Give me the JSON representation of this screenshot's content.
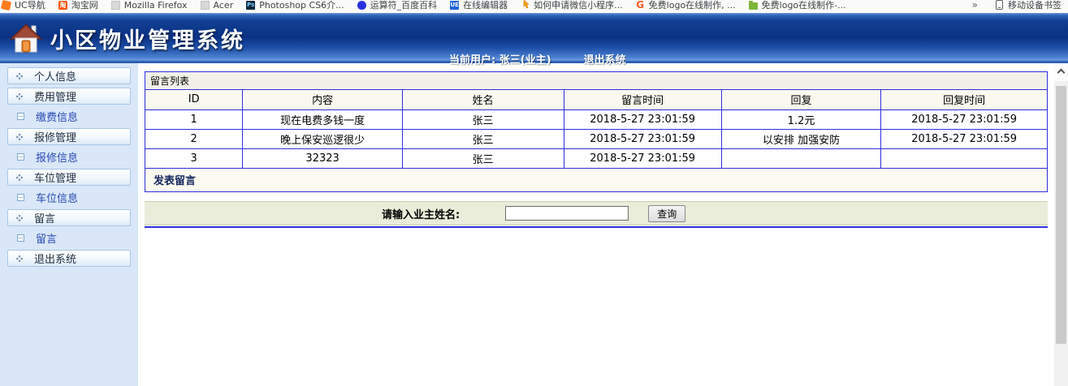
{
  "bookmarks_bar": {
    "items": [
      {
        "label": "UC导航",
        "icon": "uc-icon"
      },
      {
        "label": "淘宝网",
        "icon": "taobao-icon"
      },
      {
        "label": "Mozilla Firefox",
        "icon": "generic-page-icon"
      },
      {
        "label": "Acer",
        "icon": "generic-page-icon"
      },
      {
        "label": "Photoshop CS6介...",
        "icon": "photoshop-icon"
      },
      {
        "label": "运算符_百度百科",
        "icon": "baidu-icon"
      },
      {
        "label": "在线编辑器",
        "icon": "ue-icon"
      },
      {
        "label": "如何申请微信小程序...",
        "icon": "hand-cursor-icon"
      },
      {
        "label": "免费logo在线制作, ...",
        "icon": "g-icon"
      },
      {
        "label": "免费logo在线制作-...",
        "icon": "green-folder-icon"
      }
    ],
    "overflow_chevron": "»",
    "mobile_bookmarks_label": "移动设备书签"
  },
  "header": {
    "title": "小区物业管理系统",
    "current_user_label": "当前用户: 张三(业主)",
    "logout_label": "退出系统"
  },
  "sidebar": {
    "items": [
      {
        "label": "个人信息",
        "type": "group"
      },
      {
        "label": "费用管理",
        "type": "group"
      },
      {
        "label": "缴费信息",
        "type": "sub"
      },
      {
        "label": "报修管理",
        "type": "group"
      },
      {
        "label": "报修信息",
        "type": "sub"
      },
      {
        "label": "车位管理",
        "type": "group"
      },
      {
        "label": "车位信息",
        "type": "sub"
      },
      {
        "label": "留言",
        "type": "group"
      },
      {
        "label": "留言",
        "type": "sub"
      },
      {
        "label": "退出系统",
        "type": "group"
      }
    ]
  },
  "main": {
    "panel_title": "留言列表",
    "table": {
      "headers": [
        "ID",
        "内容",
        "姓名",
        "留言时间",
        "回复",
        "回复时间"
      ],
      "rows": [
        [
          "1",
          "现在电费多钱一度",
          "张三",
          "2018-5-27 23:01:59",
          "1.2元",
          "2018-5-27 23:01:59"
        ],
        [
          "2",
          "晚上保安巡逻很少",
          "张三",
          "2018-5-27 23:01:59",
          "以安排 加强安防",
          "2018-5-27 23:01:59"
        ],
        [
          "3",
          "32323",
          "张三",
          "2018-5-27 23:01:59",
          "",
          ""
        ]
      ]
    },
    "post_message_link": "发表留言",
    "search": {
      "label": "请输入业主姓名:",
      "input_value": "",
      "button_label": "查询"
    }
  },
  "colors": {
    "header_blue_dark": "#0a3184",
    "header_blue_light": "#4a7fd0",
    "table_border_blue": "#2e2ede",
    "sidebar_bg": "#d9e7f8",
    "panel_bg_ivory": "#fbfaf1",
    "search_strip_bg": "#e9edda"
  }
}
